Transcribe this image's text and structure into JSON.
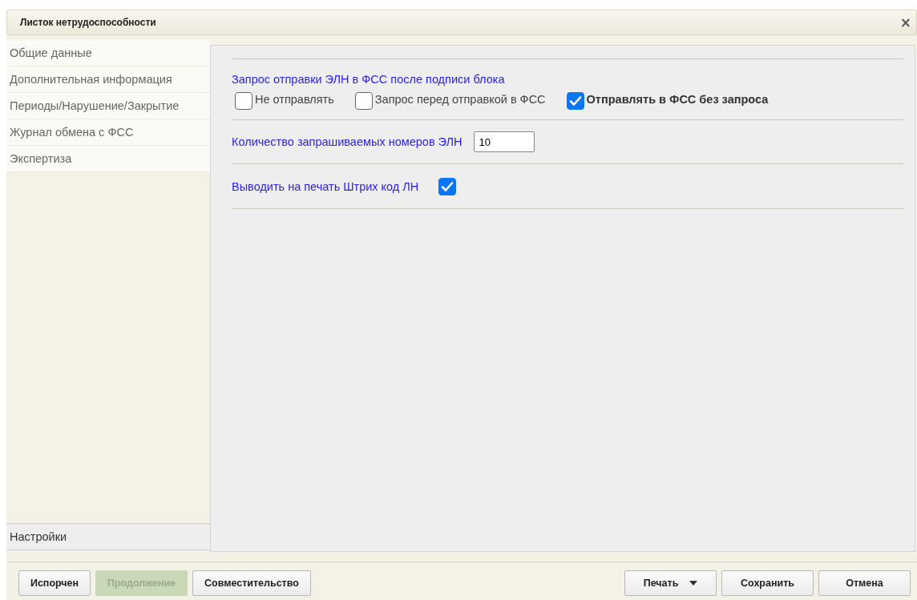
{
  "window": {
    "title": "Листок нетрудоспособности",
    "close": "×"
  },
  "sidebar": {
    "items": [
      {
        "label": "Общие данные",
        "selected": false
      },
      {
        "label": "Дополнительная информация",
        "selected": false
      },
      {
        "label": "Периоды/Нарушение/Закрытие",
        "selected": false
      },
      {
        "label": "Журнал обмена с ФСС",
        "selected": false
      },
      {
        "label": "Экспертиза",
        "selected": false
      }
    ],
    "bottom_items": [
      {
        "label": "Настройки",
        "selected": true
      }
    ]
  },
  "settings": {
    "send_request": {
      "label": "Запрос отправки ЭЛН в ФСС после подписи блока",
      "options": [
        {
          "label": "Не отправлять",
          "checked": false
        },
        {
          "label": "Запрос перед отправкой в ФСС",
          "checked": false
        },
        {
          "label": "Отправлять в ФСС без запроса",
          "checked": true
        }
      ]
    },
    "number_count": {
      "label": "Количество запрашиваемых номеров ЭЛН",
      "value": "10"
    },
    "print_barcode": {
      "label": "Выводить на печать Штрих код ЛН",
      "checked": true
    }
  },
  "footer": {
    "left_buttons": [
      {
        "label": "Испорчен",
        "disabled": false
      },
      {
        "label": "Продолжение",
        "disabled": true
      },
      {
        "label": "Совместительство",
        "disabled": false
      }
    ],
    "right_buttons": [
      {
        "label": "Печать",
        "kind": "dropdown"
      },
      {
        "label": "Сохранить",
        "kind": "plain"
      },
      {
        "label": "Отмена",
        "kind": "plain"
      }
    ]
  }
}
